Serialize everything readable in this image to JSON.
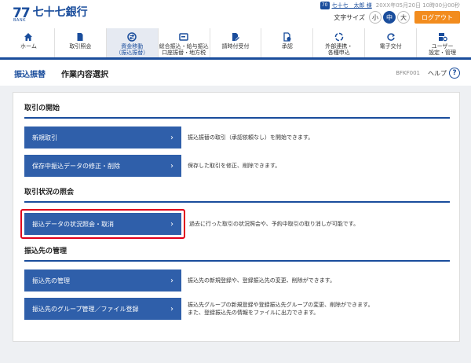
{
  "header": {
    "logo_mark": "77",
    "logo_bank": "BANK",
    "logo_text": "七十七銀行",
    "user_badge": "70",
    "user_name": "七十七　太郎 様",
    "user_time": "20XX年05月20日 10時00分00秒",
    "font_size_label": "文字サイズ",
    "font_small": "小",
    "font_medium": "中",
    "font_large": "大",
    "logout": "ログアウト"
  },
  "nav": {
    "items": [
      {
        "label1": "ホーム",
        "label2": "",
        "icon": "home-icon"
      },
      {
        "label1": "取引照会",
        "label2": "",
        "icon": "document-icon"
      },
      {
        "label1": "資金移動",
        "label2": "（振込振替）",
        "icon": "transfer-icon"
      },
      {
        "label1": "総合振込・給与振込",
        "label2": "口座振替・地方税",
        "icon": "card-icon"
      },
      {
        "label1": "請時付受付",
        "label2": "",
        "icon": "doc-edit-icon"
      },
      {
        "label1": "承認",
        "label2": "",
        "icon": "approve-icon"
      },
      {
        "label1": "外部連携・",
        "label2": "各種申込",
        "icon": "link-icon"
      },
      {
        "label1": "電子交付",
        "label2": "",
        "icon": "refresh-icon"
      },
      {
        "label1": "ユーザー",
        "label2": "設定・管理",
        "icon": "user-settings-icon"
      }
    ],
    "active_index": 2
  },
  "titlebar": {
    "main": "振込振替",
    "sub": "作業内容選択",
    "screen_id": "BFKF001",
    "help": "ヘルプ",
    "help_icon": "?"
  },
  "sections": {
    "start": {
      "title": "取引の開始",
      "new_label": "新規取引",
      "new_desc": "振込振替の取引（承認依頼なし）を開始できます。",
      "saved_label": "保存中振込データの修正・削除",
      "saved_desc": "保存した取引を修正、削除できます。"
    },
    "status": {
      "title": "取引状況の照会",
      "inquiry_label": "振込データの状況照会・取消",
      "inquiry_desc": "過去に行った取引の状況照会や、予約中取引の取り消しが可能です。"
    },
    "payee": {
      "title": "振込先の管理",
      "manage_label": "振込先の管理",
      "manage_desc": "振込先の新規登録や、登録振込先の変更、削除ができます。",
      "group_label": "振込先のグループ管理／ファイル登録",
      "group_desc1": "振込先グループの新規登録や登録振込先グループの変更、削除ができます。",
      "group_desc2": "また、登録振込先の情報をファイルに出力できます。"
    }
  },
  "chevron": "›",
  "colors": {
    "brand": "#1a4d9c",
    "button": "#2f5faa",
    "logout": "#f28c1e",
    "highlight": "#e0001b"
  }
}
